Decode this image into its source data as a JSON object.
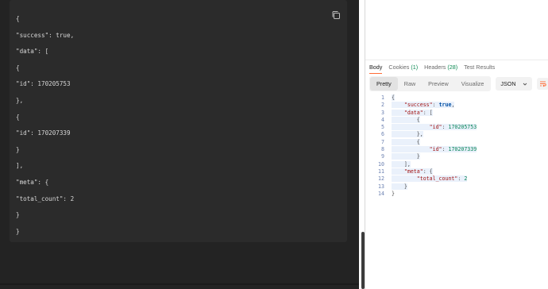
{
  "left_code": {
    "lines": [
      "{",
      "\"success\": true,",
      "\"data\": [",
      "{",
      "\"id\": 170205753",
      "},",
      "{",
      "\"id\": 170207339",
      "}",
      "],",
      "\"meta\": {",
      "\"total_count\": 2",
      "}",
      "}"
    ],
    "copy_icon": "copy-icon"
  },
  "response": {
    "tabs": [
      {
        "label": "Body",
        "count": ""
      },
      {
        "label": "Cookies",
        "count": "(1)"
      },
      {
        "label": "Headers",
        "count": "(28)"
      },
      {
        "label": "Test Results",
        "count": ""
      }
    ],
    "view_modes": [
      "Pretty",
      "Raw",
      "Preview",
      "Visualize"
    ],
    "active_view": "Pretty",
    "format": "JSON",
    "wrap_icon": "wrap-lines-icon",
    "line_numbers": [
      "1",
      "2",
      "3",
      "4",
      "5",
      "6",
      "7",
      "8",
      "9",
      "10",
      "11",
      "12",
      "13",
      "14"
    ],
    "tokens": {
      "open_brace": "{",
      "close_brace": "}",
      "open_bracket": "[",
      "close_bracket": "]",
      "close_brace_comma": "},",
      "close_bracket_comma": "],",
      "colon": ": ",
      "comma": ",",
      "success_key": "\"success\"",
      "success_val": "true",
      "data_key": "\"data\"",
      "id_key": "\"id\"",
      "id1": "170205753",
      "id2": "170207339",
      "meta_key": "\"meta\"",
      "total_key": "\"total_count\"",
      "total_val": "2"
    }
  },
  "colors": {
    "dark_bg": "#232323",
    "card_bg": "#2b2b2b",
    "accent": "#ff6c37",
    "json_key": "#a31515",
    "json_number": "#098658",
    "json_bool": "#0451a5"
  }
}
